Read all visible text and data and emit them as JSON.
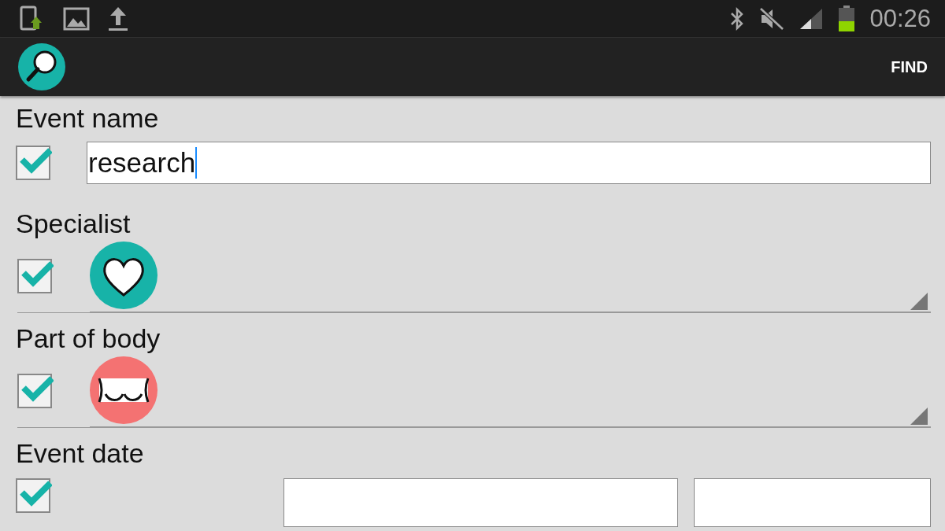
{
  "status_bar": {
    "time": "00:26"
  },
  "action_bar": {
    "button": "FIND"
  },
  "sections": [
    {
      "kind": "text",
      "label": "Event name",
      "checked": true,
      "value": "research"
    },
    {
      "kind": "spinner",
      "label": "Specialist",
      "checked": true,
      "color": "#17b3a8"
    },
    {
      "kind": "spinner",
      "label": "Part of body",
      "checked": true,
      "color": "#f47272"
    },
    {
      "kind": "date",
      "label": "Event date",
      "checked": true
    }
  ]
}
